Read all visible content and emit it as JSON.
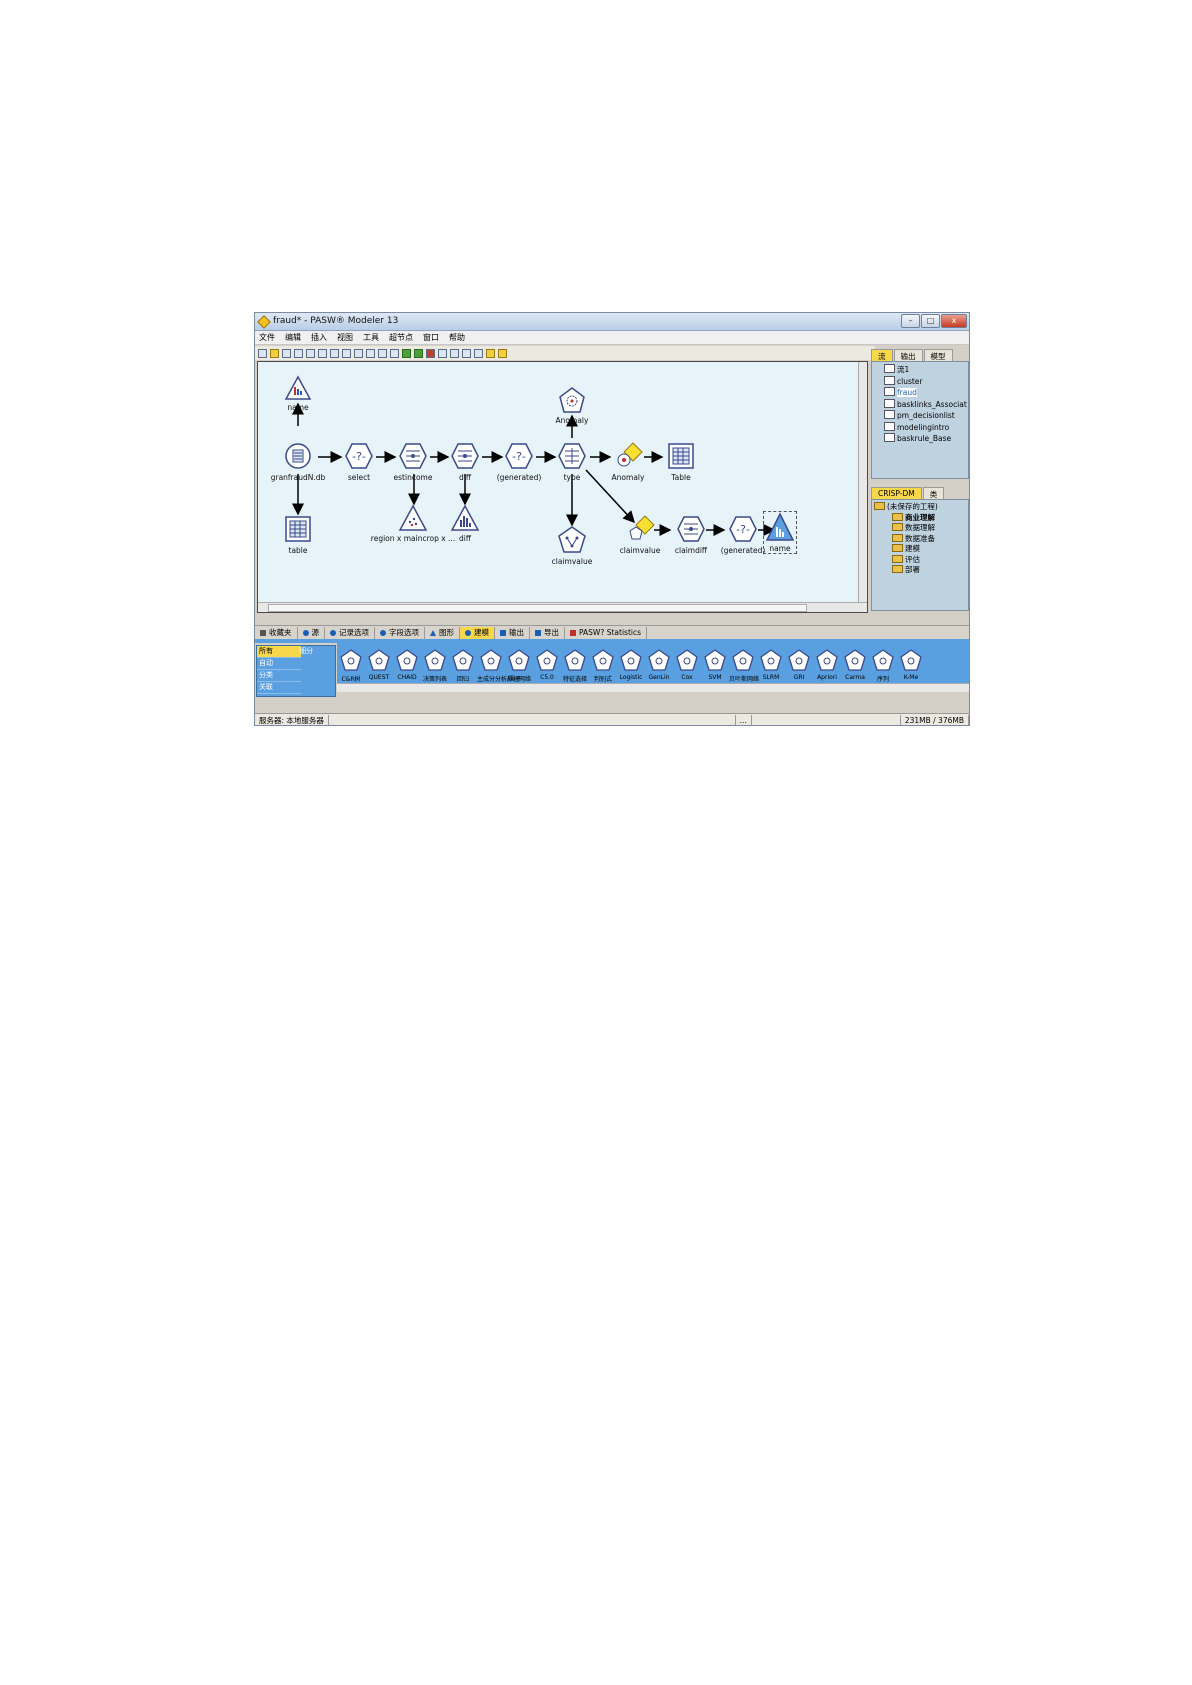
{
  "window": {
    "title": "fraud* - PASW® Modeler 13",
    "min": "–",
    "max": "□",
    "close": "x"
  },
  "menu": [
    "文件",
    "编辑",
    "插入",
    "视图",
    "工具",
    "超节点",
    "窗口",
    "帮助"
  ],
  "nodes": {
    "name_top": "name",
    "anomaly_top": "Anomaly",
    "source": "granfraudN.db",
    "select": "select",
    "estincome": "estincome",
    "diff_top": "diff",
    "generated1": "(generated)",
    "type": "type",
    "anomaly_model": "Anomaly",
    "table_right": "Table",
    "table_left": "table",
    "region": "region x maincrop x ...",
    "diff_bottom": "diff",
    "claimvalue_left": "claimvalue",
    "claimvalue_model": "claimvalue",
    "claimdiff": "claimdiff",
    "generated2": "(generated)",
    "name_bottom": "name"
  },
  "right_panel": {
    "tabs": [
      "流",
      "输出",
      "模型"
    ],
    "streams": [
      "流1",
      "cluster",
      "fraud",
      "basklinks_Associat",
      "pm_decisionlist",
      "modelingintro",
      "baskrule_Base"
    ],
    "crisp_tabs": [
      "CRISP-DM",
      "类"
    ],
    "crisp_root": "(未保存的工程)",
    "crisp_items": [
      "商业理解",
      "数据理解",
      "数据准备",
      "建模",
      "评估",
      "部署"
    ]
  },
  "palette_tabs": [
    "收藏夹",
    "源",
    "记录选项",
    "字段选项",
    "图形",
    "建模",
    "输出",
    "导出",
    "PASW? Statistics"
  ],
  "categories": [
    "所有",
    "自动",
    "分类",
    "关联"
  ],
  "category_sub": "细分",
  "palette_items": [
    "C&R树",
    "QUEST",
    "CHAID",
    "决策列表",
    "回归",
    "主成分分析/因子",
    "神经网络",
    "C5.0",
    "特征选择",
    "判别式",
    "Logistic",
    "GenLin",
    "Cox",
    "SVM",
    "贝叶斯网络",
    "SLRM",
    "GRI",
    "Apriori",
    "Carma",
    "序列",
    "K-Me"
  ],
  "status": {
    "server": "服务器: 本地服务器",
    "dots": "...",
    "memory": "231MB / 376MB"
  },
  "colors": {
    "canvas": "#e6f3f8",
    "accent": "#f7d84a",
    "palette_bg": "#5aa0e0",
    "node_stroke": "#3a4a8a"
  }
}
